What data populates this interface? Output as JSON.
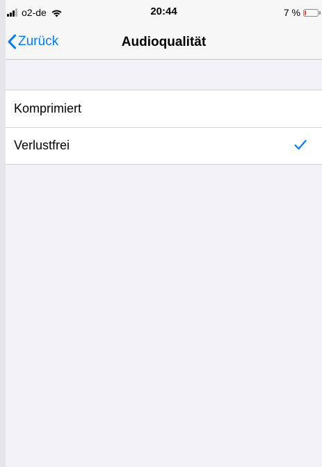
{
  "status_bar": {
    "carrier": "o2-de",
    "time": "20:44",
    "battery_text": "7 %",
    "battery_level": 0.07,
    "signal_bars_active": 3,
    "signal_bars_total": 4,
    "icons": [
      "signal-bars-icon",
      "wifi-icon",
      "battery-icon"
    ]
  },
  "nav": {
    "back_label": "Zurück",
    "title": "Audioqualität",
    "back_icon": "chevron-left-icon"
  },
  "options": {
    "items": [
      {
        "label": "Komprimiert",
        "selected": false
      },
      {
        "label": "Verlustfrei",
        "selected": true
      }
    ]
  },
  "colors": {
    "accent": "#007aff",
    "battery_low": "#ff3b30",
    "background": "#f2f2f7",
    "separator": "#d1d1d6"
  }
}
